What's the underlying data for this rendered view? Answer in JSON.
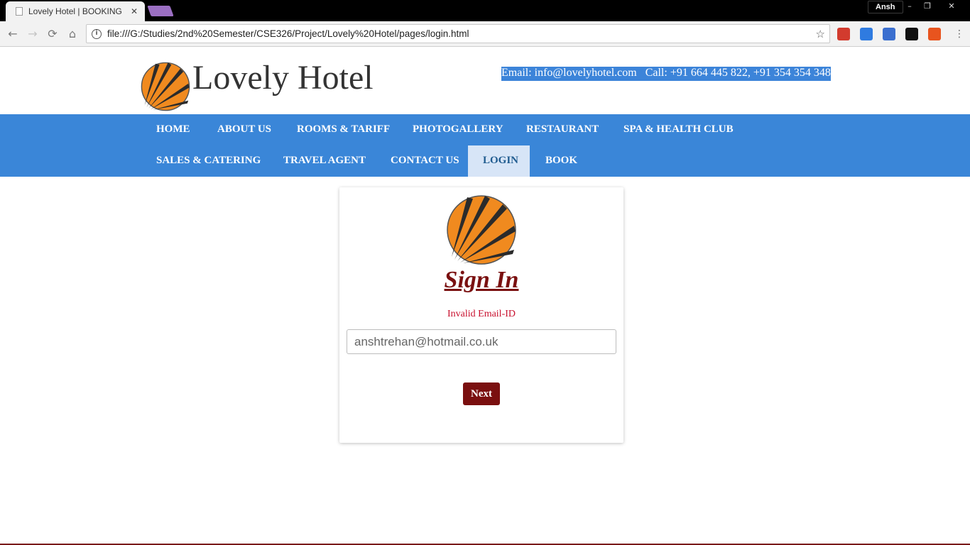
{
  "browser": {
    "tab_title": "Lovely Hotel | BOOKING",
    "tab_close": "✕",
    "profile_name": "Ansh",
    "url": "file:///G:/Studies/2nd%20Semester/CSE326/Project/Lovely%20Hotel/pages/login.html",
    "window_controls": {
      "minimize": "–",
      "restore": "❐",
      "close": "✕"
    },
    "nav": {
      "back": "←",
      "forward": "→",
      "reload": "⟳",
      "home": "⌂"
    },
    "star": "☆",
    "info": "i",
    "menu": "⋮",
    "extensions": [
      {
        "name": "stop-hand-extension-icon",
        "color": "#d23b2e"
      },
      {
        "name": "shield-extension-icon",
        "color": "#2f7be0"
      },
      {
        "name": "sync-extension-icon",
        "color": "#3b6fcf"
      },
      {
        "name": "square-extension-icon",
        "color": "#111111"
      },
      {
        "name": "fire-extension-icon",
        "color": "#e8541e"
      }
    ]
  },
  "header": {
    "site_title": "Lovely Hotel",
    "email": "Email: info@lovelyhotel.com",
    "call": "Call: +91 664 445 822, +91 354 354 348"
  },
  "nav_items": [
    {
      "label": "HOME",
      "active": false
    },
    {
      "label": "ABOUT US",
      "active": false
    },
    {
      "label": "ROOMS & TARIFF",
      "active": false
    },
    {
      "label": "PHOTOGALLERY",
      "active": false
    },
    {
      "label": "RESTAURANT",
      "active": false
    },
    {
      "label": "SPA & HEALTH CLUB",
      "active": false
    },
    {
      "label": "SALES & CATERING",
      "active": false
    },
    {
      "label": "TRAVEL AGENT",
      "active": false
    },
    {
      "label": "CONTACT US",
      "active": false
    },
    {
      "label": "LOGIN",
      "active": true
    },
    {
      "label": "BOOK",
      "active": false
    }
  ],
  "login": {
    "heading": "Sign In",
    "error": "Invalid Email-ID",
    "email_value": "anshtrehan@hotmail.co.uk",
    "next_label": "Next"
  },
  "colors": {
    "nav_bg": "#3a86d8",
    "nav_active_bg": "#d7e5f7",
    "accent_dark_red": "#7a0f0f",
    "error_red": "#c8102e",
    "logo_orange": "#f08a1f"
  }
}
